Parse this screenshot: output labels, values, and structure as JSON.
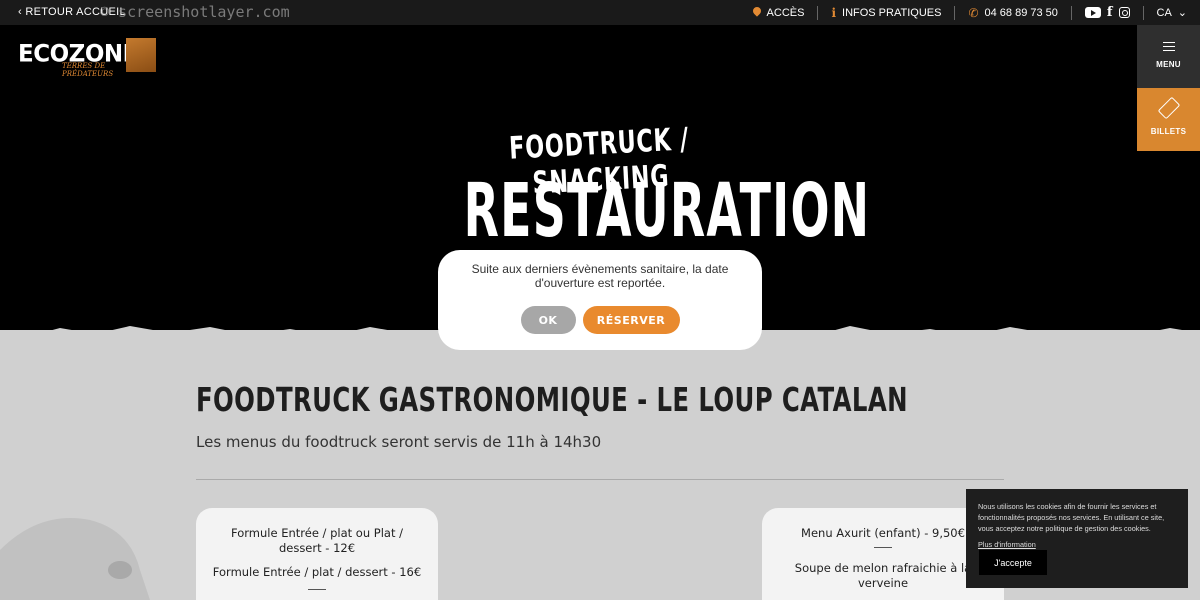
{
  "topbar": {
    "back_label": "‹ RETOUR ACCUEIL",
    "watermark": "© screenshotlayer.com",
    "acces_label": "ACCÈS",
    "infos_label": "INFOS PRATIQUES",
    "phone": "04 68 89 73 50",
    "lang": "CA"
  },
  "logo": {
    "name": "ECOZONIA",
    "tagline": "TERRES DE PRÉDATEURS"
  },
  "side": {
    "menu_label": "MENU",
    "tickets_label": "BILLETS"
  },
  "hero": {
    "subtitle": "FOODTRUCK / SNACKING",
    "title": "RESTAURATION"
  },
  "modal": {
    "message": "Suite aux derniers évènements sanitaire, la date d'ouverture est reportée.",
    "ok_label": "OK",
    "reserve_label": "RÉSERVER"
  },
  "section": {
    "title": "FOODTRUCK GASTRONOMIQUE - LE LOUP CATALAN",
    "subtitle": "Les menus du foodtruck seront servis de 11h à 14h30"
  },
  "cards": {
    "left": {
      "line1": "Formule Entrée / plat ou Plat / dessert - 12€",
      "line2": "Formule Entrée / plat / dessert - 16€"
    },
    "right": {
      "line1": "Menu Axurit (enfant) - 9,50€",
      "line2": "Soupe de melon rafraichie à la verveine"
    }
  },
  "cookie": {
    "text": "Nous utilisons les cookies afin de fournir les services et fonctionnalités proposés nos services. En utilisant ce site, vous acceptez notre politique de gestion des cookies.",
    "more_label": "Plus d'information",
    "accept_label": "J'accepte"
  },
  "colors": {
    "accent": "#e98a2e",
    "dark": "#000000",
    "grey": "#d0d0d0"
  }
}
